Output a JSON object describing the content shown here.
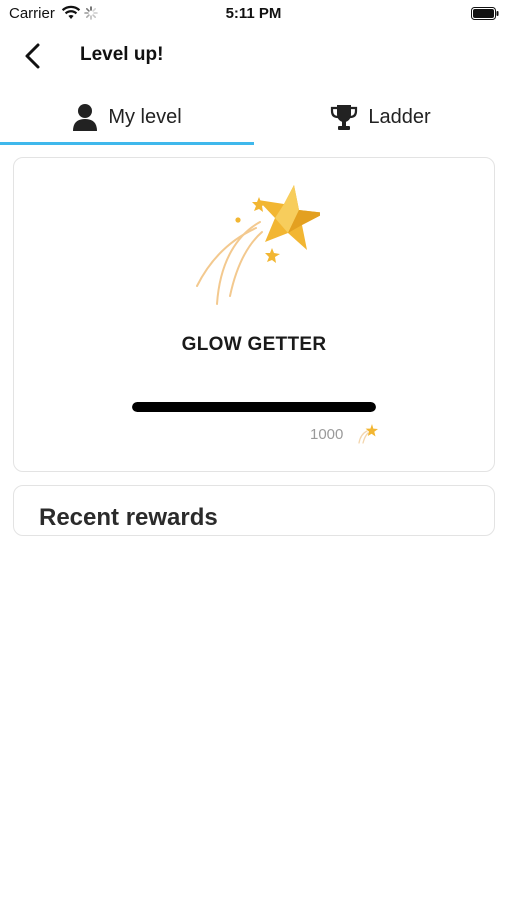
{
  "status_bar": {
    "carrier": "Carrier",
    "time": "5:11 PM"
  },
  "nav": {
    "title": "Level up!",
    "back_icon": "chevron-left-icon"
  },
  "tabs": [
    {
      "label": "My level",
      "icon": "user-icon",
      "selected": true
    },
    {
      "label": "Ladder",
      "icon": "trophy-icon",
      "selected": false
    }
  ],
  "level": {
    "name": "GLOW GETTER",
    "illustration": "shooting-star-icon",
    "progress_fraction": 1.0,
    "points": "1000",
    "points_icon": "shooting-star-small-icon"
  },
  "rewards": {
    "title": "Recent rewards"
  },
  "colors": {
    "tab_indicator": "#3fb8ec",
    "star": "#f2b632",
    "progress": "#000000"
  }
}
